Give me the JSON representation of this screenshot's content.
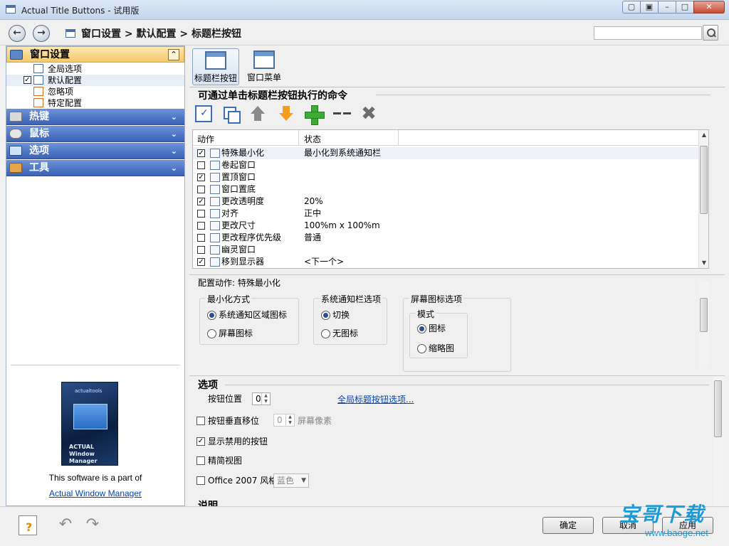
{
  "window": {
    "title": "Actual Title Buttons - 试用版"
  },
  "nav": {
    "breadcrumb": "窗口设置 > 默认配置 > 标题栏按钮",
    "search_placeholder": ""
  },
  "sidebar": {
    "sections": [
      {
        "label": "窗口设置",
        "icon": "window-settings-icon",
        "expanded": true
      },
      {
        "label": "热键",
        "icon": "keyboard-icon"
      },
      {
        "label": "鼠标",
        "icon": "mouse-icon"
      },
      {
        "label": "选项",
        "icon": "options-icon"
      },
      {
        "label": "工具",
        "icon": "tools-icon"
      }
    ],
    "tree": [
      {
        "label": "全局选项",
        "checked": false,
        "has_checkbox": false
      },
      {
        "label": "默认配置",
        "checked": true,
        "has_checkbox": true
      },
      {
        "label": "忽略项",
        "checked": false,
        "has_checkbox": false
      },
      {
        "label": "特定配置",
        "checked": false,
        "has_checkbox": false
      }
    ],
    "promo": {
      "box_brand": "actualtools",
      "box_product": "ACTUAL Window Manager",
      "text": "This software is a part of",
      "link": "Actual Window Manager"
    }
  },
  "top_buttons": [
    {
      "label": "标题栏按钮",
      "active": true
    },
    {
      "label": "窗口菜单",
      "active": false
    }
  ],
  "commands": {
    "title": "可通过单击标题栏按钮执行的命令",
    "toolbar": [
      "check-all-icon",
      "copy-icon",
      "move-up-icon",
      "move-down-icon",
      "add-icon",
      "separator-icon",
      "delete-icon"
    ],
    "columns": [
      "动作",
      "状态"
    ],
    "rows": [
      {
        "checked": true,
        "action": "特殊最小化",
        "state": "最小化到系统通知栏"
      },
      {
        "checked": false,
        "action": "卷起窗口",
        "state": ""
      },
      {
        "checked": true,
        "action": "置顶窗口",
        "state": ""
      },
      {
        "checked": false,
        "action": "窗口置底",
        "state": ""
      },
      {
        "checked": true,
        "action": "更改透明度",
        "state": "20%"
      },
      {
        "checked": false,
        "action": "对齐",
        "state": "正中"
      },
      {
        "checked": false,
        "action": "更改尺寸",
        "state": "100%m x 100%m"
      },
      {
        "checked": false,
        "action": "更改程序优先级",
        "state": "普通"
      },
      {
        "checked": false,
        "action": "幽灵窗口",
        "state": ""
      },
      {
        "checked": true,
        "action": "移到显示器",
        "state": "<下一个>"
      }
    ]
  },
  "config": {
    "title": "配置动作: 特殊最小化",
    "minimize_mode": {
      "title": "最小化方式",
      "options": [
        "系统通知区域图标",
        "屏幕图标"
      ],
      "selected": 0
    },
    "tray_options": {
      "title": "系统通知栏选项",
      "options": [
        "切换",
        "无图标"
      ],
      "selected": 0
    },
    "screen_icon_options": {
      "title": "屏幕图标选项",
      "mode_title": "模式",
      "options": [
        "图标",
        "缩略图"
      ],
      "selected": 0
    }
  },
  "options": {
    "title": "选项",
    "button_position_label": "按钮位置",
    "button_position_value": "0",
    "global_link": "全局标题按钮选项...",
    "vertical_offset_label": "按钮垂直移位",
    "vertical_offset_value": "0",
    "vertical_offset_unit": "屏幕像素",
    "show_disabled_label": "显示禁用的按钮",
    "show_disabled_checked": true,
    "compact_view_label": "精简视图",
    "office_style_label": "Office 2007 风格",
    "office_style_value": "蓝色",
    "description_title": "说明"
  },
  "footer": {
    "ok": "确定",
    "cancel": "取消",
    "apply": "应用"
  },
  "watermark": {
    "line1": "宝哥下载",
    "line2": "www.baoge.net"
  }
}
